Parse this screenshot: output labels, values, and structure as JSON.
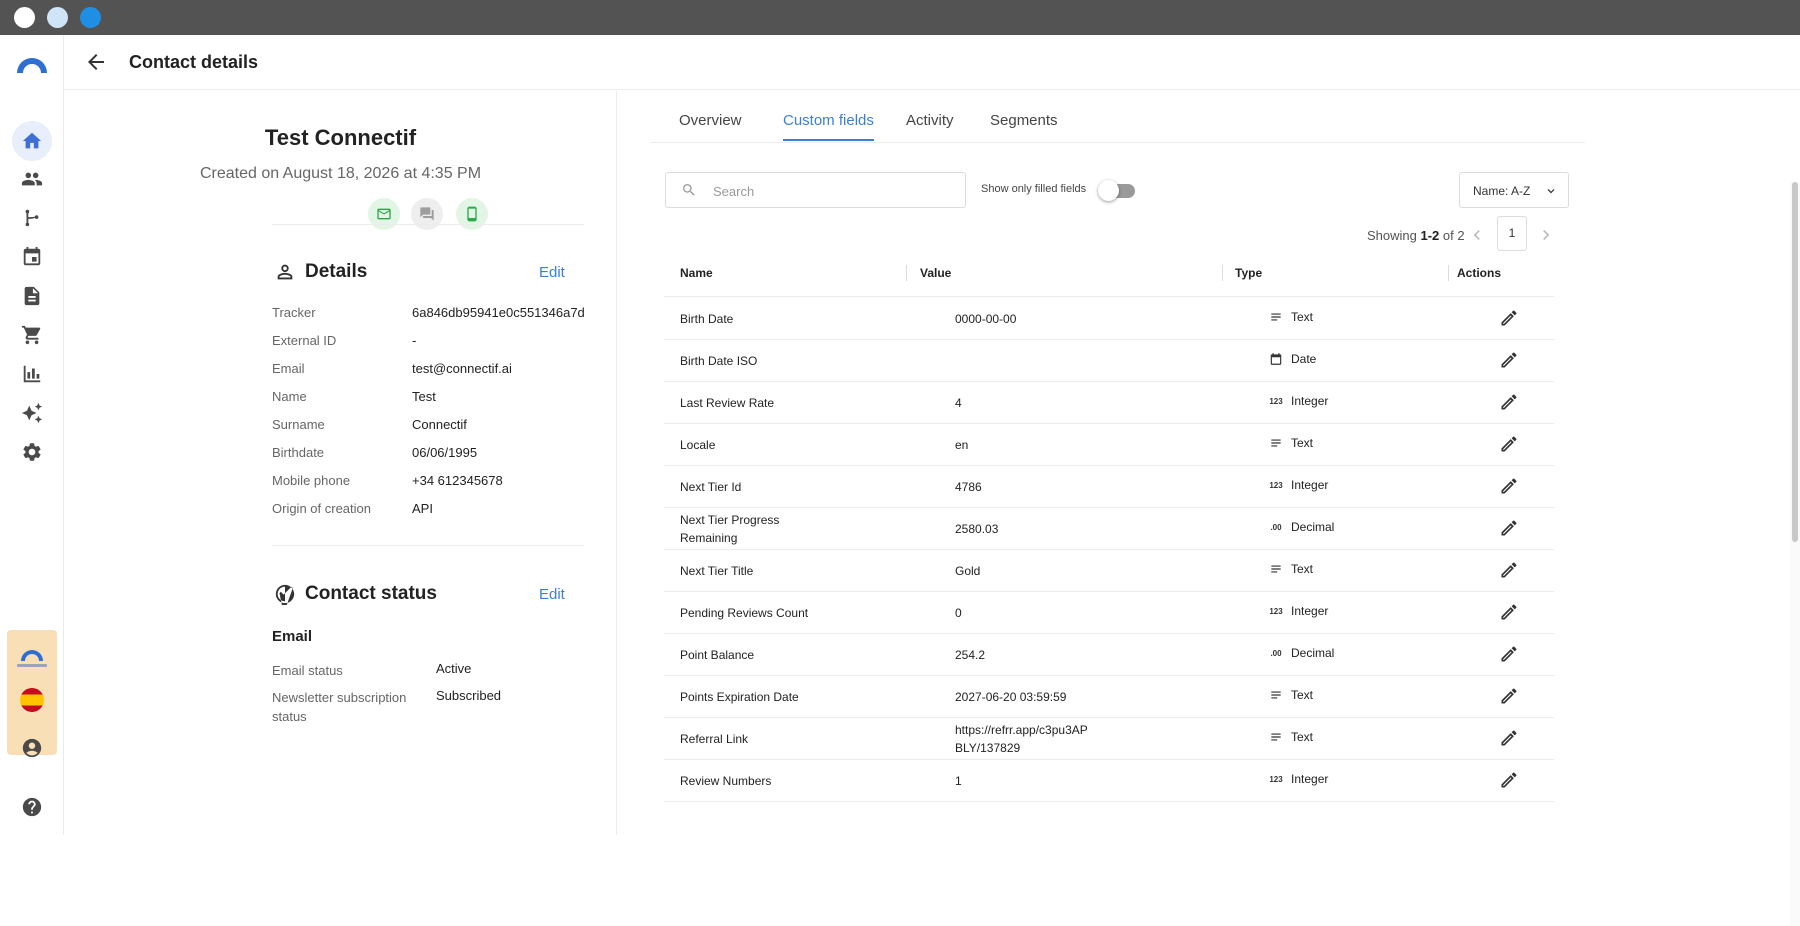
{
  "header": {
    "title": "Contact details"
  },
  "contact": {
    "name": "Test Connectif",
    "created": "Created on August 18, 2026 at 4:35 PM"
  },
  "details": {
    "title": "Details",
    "edit_label": "Edit",
    "fields": [
      {
        "label": "Tracker",
        "value": "6a846db95941e0c551346a7d"
      },
      {
        "label": "External ID",
        "value": "-"
      },
      {
        "label": "Email",
        "value": "test@connectif.ai"
      },
      {
        "label": "Name",
        "value": "Test"
      },
      {
        "label": "Surname",
        "value": "Connectif"
      },
      {
        "label": "Birthdate",
        "value": "06/06/1995"
      },
      {
        "label": "Mobile phone",
        "value": "+34 612345678"
      },
      {
        "label": "Origin of creation",
        "value": "API"
      }
    ]
  },
  "status": {
    "title": "Contact status",
    "edit_label": "Edit",
    "email_heading": "Email",
    "rows": [
      {
        "label": "Email status",
        "value": "Active"
      },
      {
        "label": "Newsletter subscription status",
        "value": "Subscribed"
      }
    ]
  },
  "tabs": [
    "Overview",
    "Custom fields",
    "Activity",
    "Segments"
  ],
  "active_tab": "Custom fields",
  "toolbar": {
    "search_placeholder": "Search",
    "toggle_label": "Show only filled fields",
    "toggle_on": false,
    "sort_label": "Name: A-Z"
  },
  "paging": {
    "prefix": "Showing ",
    "range": "1-2",
    "suffix": " of 2",
    "page": "1"
  },
  "table": {
    "headers": {
      "name": "Name",
      "value": "Value",
      "type": "Type",
      "actions": "Actions"
    },
    "rows": [
      {
        "name": "Birth Date",
        "value": "0000-00-00",
        "type": "Text",
        "type_icon": "text-icon"
      },
      {
        "name": "Birth Date ISO",
        "value": "",
        "type": "Date",
        "type_icon": "calendar-icon"
      },
      {
        "name": "Last Review Rate",
        "value": "4",
        "type": "Integer",
        "type_icon": "integer-icon"
      },
      {
        "name": "Locale",
        "value": "en",
        "type": "Text",
        "type_icon": "text-icon"
      },
      {
        "name": "Next Tier Id",
        "value": "4786",
        "type": "Integer",
        "type_icon": "integer-icon"
      },
      {
        "name": "Next Tier Progress Remaining",
        "value": "2580.03",
        "type": "Decimal",
        "type_icon": "decimal-icon"
      },
      {
        "name": "Next Tier Title",
        "value": "Gold",
        "type": "Text",
        "type_icon": "text-icon"
      },
      {
        "name": "Pending Reviews Count",
        "value": "0",
        "type": "Integer",
        "type_icon": "integer-icon"
      },
      {
        "name": "Point Balance",
        "value": "254.2",
        "type": "Decimal",
        "type_icon": "decimal-icon"
      },
      {
        "name": "Points Expiration Date",
        "value": "2027-06-20 03:59:59",
        "type": "Text",
        "type_icon": "text-icon"
      },
      {
        "name": "Referral Link",
        "value": "https://refrr.app/c3pu3AP BLY/137829",
        "type": "Text",
        "type_icon": "text-icon"
      },
      {
        "name": "Review Numbers",
        "value": "1",
        "type": "Integer",
        "type_icon": "integer-icon"
      }
    ]
  },
  "colors": {
    "accent": "#3d7fd6",
    "titlebar": "#535353",
    "badge_bg": "#f8dfb6"
  }
}
